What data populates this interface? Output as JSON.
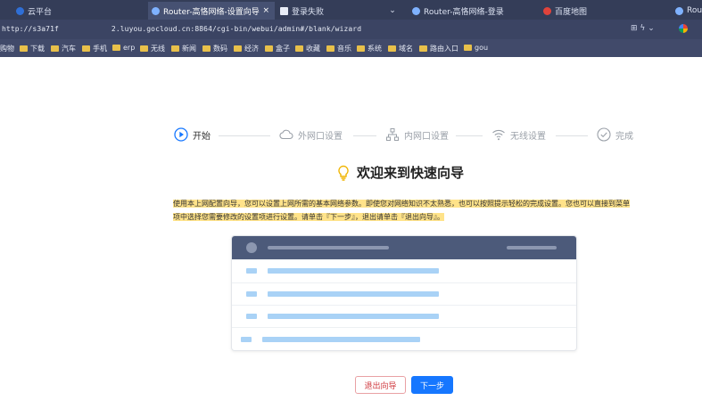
{
  "browser": {
    "tabs": [
      {
        "label": "云平台",
        "active": false,
        "close": ""
      },
      {
        "label": "Router-高恪网络-设置向导",
        "active": true,
        "close": "×"
      },
      {
        "label": "登录失败",
        "active": false,
        "close": ""
      },
      {
        "label": "Router-高恪网络-登录",
        "active": false,
        "close": ""
      },
      {
        "label": "百度地图",
        "active": false,
        "close": ""
      },
      {
        "label": "Rout",
        "active": false,
        "close": ""
      }
    ],
    "tab_dropdown": "⌄",
    "address": "http://s3a71f            2.luyou.gocloud.cn:8864/cgi-bin/webui/admin#/blank/wizard",
    "toolbar_icons": "⊞  ϟ  ⌄",
    "bookmarks": [
      "购物",
      "下载",
      "汽车",
      "手机",
      "erp",
      "无线",
      "新闻",
      "数码",
      "经济",
      "盒子",
      "收藏",
      "音乐",
      "系统",
      "域名",
      "路由入口",
      "gou"
    ]
  },
  "wizard": {
    "steps": [
      "开始",
      "外网口设置",
      "内网口设置",
      "无线设置",
      "完成"
    ],
    "active_step": 0,
    "title": "欢迎来到快速向导",
    "description": "使用本上网配置向导，您可以设置上网所需的基本网络参数。即使您对网络知识不太熟悉，也可以按照提示轻松的完成设置。您也可以直接到菜单项中选择您需要修改的设置项进行设置。请单击『下一步』，退出请单击『退出向导』。",
    "exit_button": "退出向导",
    "next_button": "下一步"
  },
  "colors": {
    "accent": "#1677ff",
    "danger": "#d03a3f",
    "highlight": "#ffe38a",
    "tab_bar": "#343d58"
  }
}
